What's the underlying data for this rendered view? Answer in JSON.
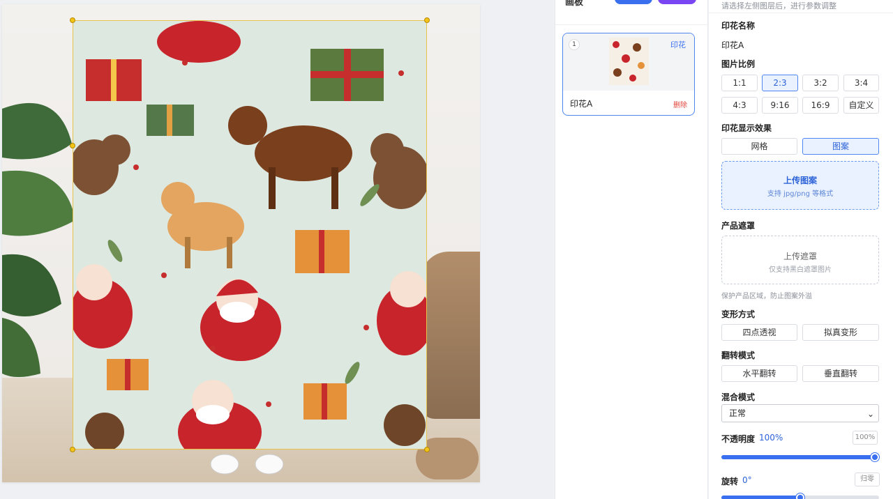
{
  "layers_panel": {
    "title": "画板",
    "pill_blue": "",
    "pill_purple": "",
    "layer": {
      "index": "1",
      "tag": "印花",
      "name": "印花A",
      "delete_label": "删除"
    }
  },
  "props": {
    "hint": "请选择左侧图层后，进行参数调整",
    "print_name_label": "印花名称",
    "print_name_value": "印花A",
    "ratio_label": "图片比例",
    "ratios": [
      "1:1",
      "2:3",
      "3:2",
      "3:4",
      "4:3",
      "9:16",
      "16:9",
      "自定义"
    ],
    "ratio_selected": "2:3",
    "display_label": "印花显示效果",
    "display_opts": [
      "网格",
      "图案"
    ],
    "display_selected": "图案",
    "upload_pattern_title": "上传图案",
    "upload_pattern_sub": "支持 jpg/png 等格式",
    "mask_label": "产品遮罩",
    "upload_mask_title": "上传遮罩",
    "upload_mask_sub": "仅支持黑白遮罩图片",
    "mask_note": "保护产品区域，防止图案外溢",
    "transform_label": "变形方式",
    "transform_opts": [
      "四点透视",
      "拟真变形"
    ],
    "flip_label": "翻转模式",
    "flip_opts": [
      "水平翻转",
      "垂直翻转"
    ],
    "blend_label": "混合模式",
    "blend_value": "正常",
    "opacity_label": "不透明度",
    "opacity_value": "100%",
    "opacity_box": "100%",
    "rotate_label": "旋转",
    "rotate_value": "0°",
    "rotate_reset": "归零"
  },
  "colors": {
    "accent": "#3a6ff0",
    "accent_purple": "#7a45f2",
    "selection": "#e8c14a",
    "danger": "#e0453a"
  }
}
